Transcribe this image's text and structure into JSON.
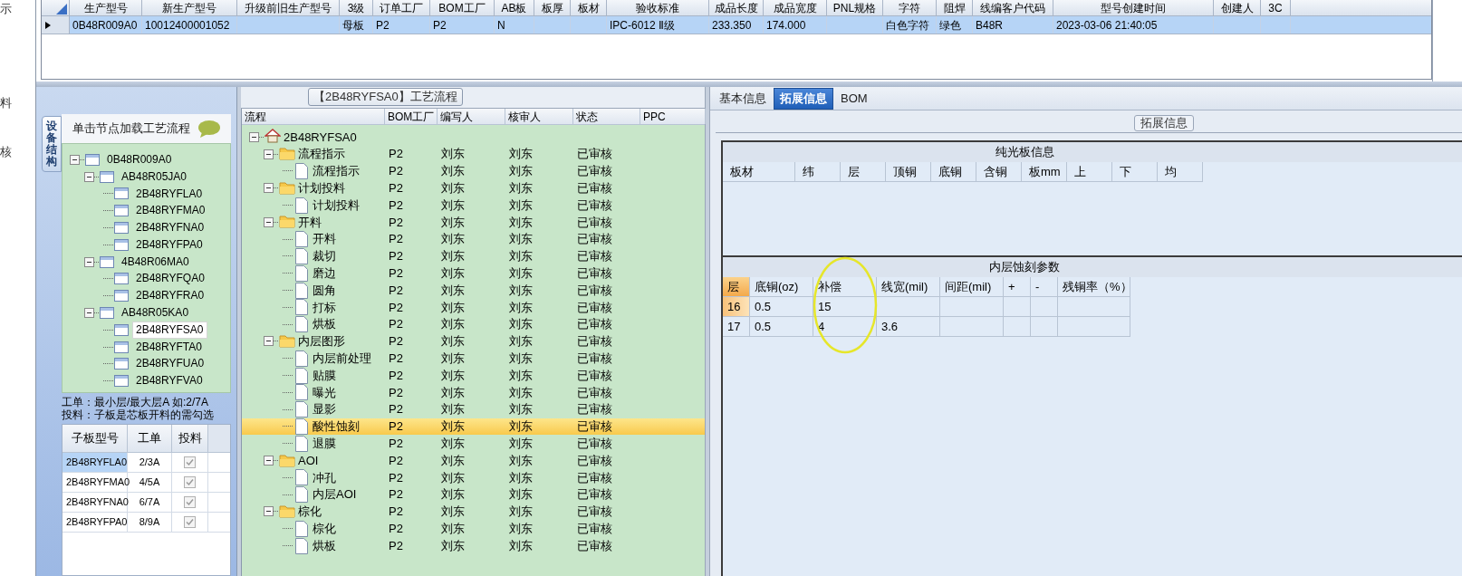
{
  "left_edge": {
    "labels": [
      "示",
      "料",
      "核"
    ]
  },
  "top_grid": {
    "columns": [
      "生产型号",
      "新生产型号",
      "升级前旧生产型号",
      "3级",
      "订单工厂",
      "BOM工厂",
      "AB板",
      "板厚",
      "板材",
      "验收标准",
      "成品长度",
      "成品宽度",
      "PNL规格",
      "字符",
      "阻焊",
      "线编客户代码",
      "型号创建时间",
      "创建人",
      "3C"
    ],
    "rows": [
      {
        "selected": true,
        "cells": [
          "0B48R009A0",
          "10012400001052",
          null,
          "母板",
          "P2",
          "P2",
          "N",
          null,
          null,
          "IPC-6012 Ⅱ级",
          "233.350",
          "174.000",
          null,
          "白色字符",
          "绿色",
          "B48R",
          "2023-03-06 21:40:05",
          null,
          null
        ]
      }
    ]
  },
  "device_panel": {
    "side_tab": "设备结构",
    "header": "单击节点加载工艺流程",
    "tree": [
      {
        "label": "0B48R009A0",
        "selected": false,
        "expanded": true,
        "children": [
          {
            "label": "AB48R05JA0",
            "selected": false,
            "expanded": true,
            "children": [
              {
                "label": "2B48RYFLA0",
                "selected": false
              },
              {
                "label": "2B48RYFMA0",
                "selected": false
              },
              {
                "label": "2B48RYFNA0",
                "selected": false
              },
              {
                "label": "2B48RYFPA0",
                "selected": false
              }
            ]
          },
          {
            "label": "4B48R06MA0",
            "selected": false,
            "expanded": true,
            "children": [
              {
                "label": "2B48RYFQA0",
                "selected": false
              },
              {
                "label": "2B48RYFRA0",
                "selected": false
              }
            ]
          },
          {
            "label": "AB48R05KA0",
            "selected": false,
            "expanded": true,
            "children": [
              {
                "label": "2B48RYFSA0",
                "selected": true
              },
              {
                "label": "2B48RYFTA0",
                "selected": false
              },
              {
                "label": "2B48RYFUA0",
                "selected": false
              },
              {
                "label": "2B48RYFVA0",
                "selected": false
              }
            ]
          }
        ]
      }
    ],
    "note_lines": [
      "工单：最小层/最大层A 如:2/7A",
      "投料：子板是芯板开料的需勾选"
    ],
    "grid": {
      "columns": [
        "子板型号",
        "工单",
        "投料"
      ],
      "rows": [
        {
          "cells": [
            "2B48RYFLA0",
            "2/3A"
          ],
          "checked": true,
          "selected": true
        },
        {
          "cells": [
            "2B48RYFMA0",
            "4/5A"
          ],
          "checked": true,
          "selected": false
        },
        {
          "cells": [
            "2B48RYFNA0",
            "6/7A"
          ],
          "checked": true,
          "selected": false
        },
        {
          "cells": [
            "2B48RYFPA0",
            "8/9A"
          ],
          "checked": true,
          "selected": false
        }
      ]
    }
  },
  "flow_panel": {
    "title": "【2B48RYFSA0】工艺流程",
    "columns": [
      "流程",
      "BOM工厂",
      "编写人",
      "核审人",
      "状态",
      "PPC"
    ],
    "tree": [
      {
        "label": "2B48RYFSA0",
        "kind": "root",
        "expanded": true,
        "selected": false,
        "children": [
          {
            "label": "流程指示",
            "kind": "folder",
            "expanded": true,
            "selected": false,
            "cells": [
              "P2",
              "刘东",
              "刘东",
              "已审核"
            ],
            "children": [
              {
                "label": "流程指示",
                "kind": "step",
                "selected": false,
                "cells": [
                  "P2",
                  "刘东",
                  "刘东",
                  "已审核"
                ]
              }
            ]
          },
          {
            "label": "计划投料",
            "kind": "folder",
            "expanded": true,
            "selected": false,
            "cells": [
              "P2",
              "刘东",
              "刘东",
              "已审核"
            ],
            "children": [
              {
                "label": "计划投料",
                "kind": "step",
                "selected": false,
                "cells": [
                  "P2",
                  "刘东",
                  "刘东",
                  "已审核"
                ]
              }
            ]
          },
          {
            "label": "开料",
            "kind": "folder",
            "expanded": true,
            "selected": false,
            "cells": [
              "P2",
              "刘东",
              "刘东",
              "已审核"
            ],
            "children": [
              {
                "label": "开料",
                "kind": "step",
                "selected": false,
                "cells": [
                  "P2",
                  "刘东",
                  "刘东",
                  "已审核"
                ]
              },
              {
                "label": "裁切",
                "kind": "step",
                "selected": false,
                "cells": [
                  "P2",
                  "刘东",
                  "刘东",
                  "已审核"
                ]
              },
              {
                "label": "磨边",
                "kind": "step",
                "selected": false,
                "cells": [
                  "P2",
                  "刘东",
                  "刘东",
                  "已审核"
                ]
              },
              {
                "label": "圆角",
                "kind": "step",
                "selected": false,
                "cells": [
                  "P2",
                  "刘东",
                  "刘东",
                  "已审核"
                ]
              },
              {
                "label": "打标",
                "kind": "step",
                "selected": false,
                "cells": [
                  "P2",
                  "刘东",
                  "刘东",
                  "已审核"
                ]
              },
              {
                "label": "烘板",
                "kind": "step",
                "selected": false,
                "cells": [
                  "P2",
                  "刘东",
                  "刘东",
                  "已审核"
                ]
              }
            ]
          },
          {
            "label": "内层图形",
            "kind": "folder",
            "expanded": true,
            "selected": false,
            "cells": [
              "P2",
              "刘东",
              "刘东",
              "已审核"
            ],
            "children": [
              {
                "label": "内层前处理",
                "kind": "step",
                "selected": false,
                "cells": [
                  "P2",
                  "刘东",
                  "刘东",
                  "已审核"
                ]
              },
              {
                "label": "贴膜",
                "kind": "step",
                "selected": false,
                "cells": [
                  "P2",
                  "刘东",
                  "刘东",
                  "已审核"
                ]
              },
              {
                "label": "曝光",
                "kind": "step",
                "selected": false,
                "cells": [
                  "P2",
                  "刘东",
                  "刘东",
                  "已审核"
                ]
              },
              {
                "label": "显影",
                "kind": "step",
                "selected": false,
                "cells": [
                  "P2",
                  "刘东",
                  "刘东",
                  "已审核"
                ]
              },
              {
                "label": "酸性蚀刻",
                "kind": "step",
                "selected": true,
                "cells": [
                  "P2",
                  "刘东",
                  "刘东",
                  "已审核"
                ]
              },
              {
                "label": "退膜",
                "kind": "step",
                "selected": false,
                "cells": [
                  "P2",
                  "刘东",
                  "刘东",
                  "已审核"
                ]
              }
            ]
          },
          {
            "label": "AOI",
            "kind": "folder",
            "expanded": true,
            "selected": false,
            "cells": [
              "P2",
              "刘东",
              "刘东",
              "已审核"
            ],
            "children": [
              {
                "label": "冲孔",
                "kind": "step",
                "selected": false,
                "cells": [
                  "P2",
                  "刘东",
                  "刘东",
                  "已审核"
                ]
              },
              {
                "label": "内层AOI",
                "kind": "step",
                "selected": false,
                "cells": [
                  "P2",
                  "刘东",
                  "刘东",
                  "已审核"
                ]
              }
            ]
          },
          {
            "label": "棕化",
            "kind": "folder",
            "expanded": true,
            "selected": false,
            "cells": [
              "P2",
              "刘东",
              "刘东",
              "已审核"
            ],
            "children": [
              {
                "label": "棕化",
                "kind": "step",
                "selected": false,
                "cells": [
                  "P2",
                  "刘东",
                  "刘东",
                  "已审核"
                ]
              },
              {
                "label": "烘板",
                "kind": "step",
                "selected": false,
                "cells": [
                  "P2",
                  "刘东",
                  "刘东",
                  "已审核"
                ]
              }
            ]
          }
        ]
      }
    ]
  },
  "info_panel": {
    "tabs": [
      {
        "label": "基本信息",
        "selected": false
      },
      {
        "label": "拓展信息",
        "selected": true
      },
      {
        "label": "BOM",
        "selected": false
      }
    ],
    "group_title": "拓展信息",
    "plain_board": {
      "title": "纯光板信息",
      "columns": [
        "板材",
        "纬",
        "层",
        "顶铜",
        "底铜",
        "含铜",
        "板mm",
        "上",
        "下",
        "均"
      ]
    },
    "inner_etch": {
      "title": "内层蚀刻参数",
      "columns": [
        "层",
        "底铜(oz)",
        "补偿",
        "线宽(mil)",
        "间距(mil)",
        "+",
        "-",
        "残铜率（%）"
      ],
      "rows": [
        {
          "selected": true,
          "cells": [
            "16",
            "0.5",
            "15",
            null,
            null,
            null,
            null,
            null
          ]
        },
        {
          "selected": false,
          "cells": [
            "17",
            "0.5",
            "4",
            "3.6",
            null,
            null,
            null,
            null
          ]
        }
      ]
    }
  }
}
